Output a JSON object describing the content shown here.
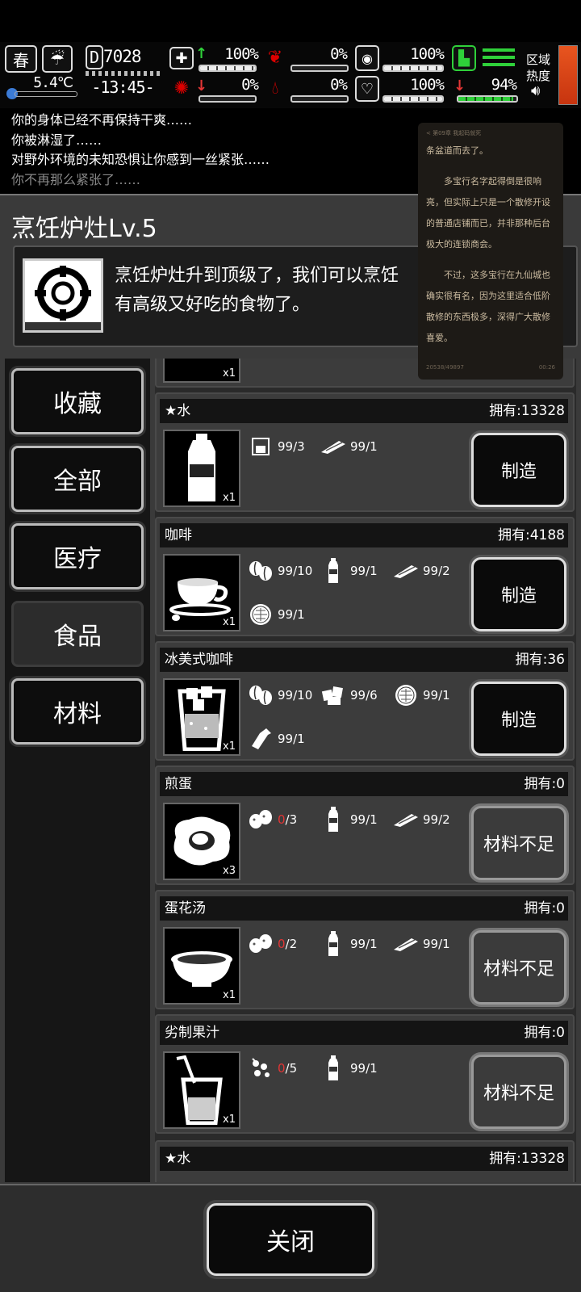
{
  "hud": {
    "season": "春",
    "temperature": "5.4℃",
    "day": "7028",
    "day_prefix": "D",
    "time": "-13:45-",
    "health_pct": "100%",
    "hunger_pct": "0%",
    "sanity_pct": "100%",
    "infection_pct": "0%",
    "thirst_pct": "0%",
    "mood_pct": "100%",
    "stamina_pct": "94%",
    "zone_heat_label": "区域热度"
  },
  "log": [
    "你的身体已经不再保持干爽……",
    "你被淋湿了……",
    "对野外环境的未知恐惧让你感到一丝紧张……",
    "你不再那么紧张了……"
  ],
  "popup": {
    "header": "< 第09章 我起码就死",
    "paragraphs": [
      "条盆道而去了。",
      "多宝行名字起得倒是很响亮，但实际上只是一个散修开设的普通店铺而已，并非那种后台极大的连锁商会。",
      "不过，这多宝行在九仙城也确实很有名，因为这里适合低阶散修的东西极多，深得广大散修喜爱。"
    ],
    "footer_left": "20538/49897",
    "footer_right": "00:26"
  },
  "panel": {
    "title": "烹饪炉灶Lv.5",
    "desc_line1": "烹饪炉灶升到顶级了，我们可以烹饪",
    "desc_line2": "有高级又好吃的食物了。"
  },
  "tabs": [
    {
      "label": "收藏"
    },
    {
      "label": "全部"
    },
    {
      "label": "医疗"
    },
    {
      "label": "食品"
    },
    {
      "label": "材料"
    }
  ],
  "partial_top_qty": "x1",
  "recipes": [
    {
      "name": "水",
      "own": "拥有:13328",
      "qty": "x1",
      "button": "制造",
      "ingredients": [
        {
          "icon": "filter-icon",
          "have": "99",
          "need": "/3"
        },
        {
          "icon": "cloth-icon",
          "have": "99",
          "need": "/1"
        }
      ]
    },
    {
      "name": "咖啡",
      "own": "拥有:4188",
      "qty": "x1",
      "button": "制造",
      "ingredients": [
        {
          "icon": "coffee-bean-icon",
          "have": "99",
          "need": "/10"
        },
        {
          "icon": "water-bottle-icon",
          "have": "99",
          "need": "/1"
        },
        {
          "icon": "cloth-icon",
          "have": "99",
          "need": "/2"
        },
        {
          "icon": "sieve-icon",
          "have": "99",
          "need": "/1"
        }
      ]
    },
    {
      "name": "冰美式咖啡",
      "own": "拥有:36",
      "qty": "x1",
      "button": "制造",
      "ingredients": [
        {
          "icon": "coffee-bean-icon",
          "have": "99",
          "need": "/10"
        },
        {
          "icon": "ice-icon",
          "have": "99",
          "need": "/6"
        },
        {
          "icon": "sieve-icon",
          "have": "99",
          "need": "/1"
        },
        {
          "icon": "glass-bottle-icon",
          "have": "99",
          "need": "/1"
        }
      ]
    },
    {
      "name": "煎蛋",
      "own": "拥有:0",
      "qty": "x3",
      "button": "材料不足",
      "ingredients": [
        {
          "icon": "egg-icon",
          "have": "0",
          "need": "/3"
        },
        {
          "icon": "water-bottle-icon",
          "have": "99",
          "need": "/1"
        },
        {
          "icon": "cloth-icon",
          "have": "99",
          "need": "/2"
        }
      ]
    },
    {
      "name": "蛋花汤",
      "own": "拥有:0",
      "qty": "x1",
      "button": "材料不足",
      "ingredients": [
        {
          "icon": "egg-icon",
          "have": "0",
          "need": "/2"
        },
        {
          "icon": "water-bottle-icon",
          "have": "99",
          "need": "/1"
        },
        {
          "icon": "cloth-icon",
          "have": "99",
          "need": "/1"
        }
      ]
    },
    {
      "name": "劣制果汁",
      "own": "拥有:0",
      "qty": "x1",
      "button": "材料不足",
      "ingredients": [
        {
          "icon": "berries-icon",
          "have": "0",
          "need": "/5"
        },
        {
          "icon": "water-bottle-icon",
          "have": "99",
          "need": "/1"
        }
      ]
    }
  ],
  "partial_bottom": {
    "name": "水",
    "own": "拥有:13328"
  },
  "close_label": "关闭",
  "colors": {
    "panel": "#3a3a3a",
    "stamina_green": "#2fd13a",
    "shortage_red": "#e23535",
    "heat_orange": "#e8551f"
  }
}
